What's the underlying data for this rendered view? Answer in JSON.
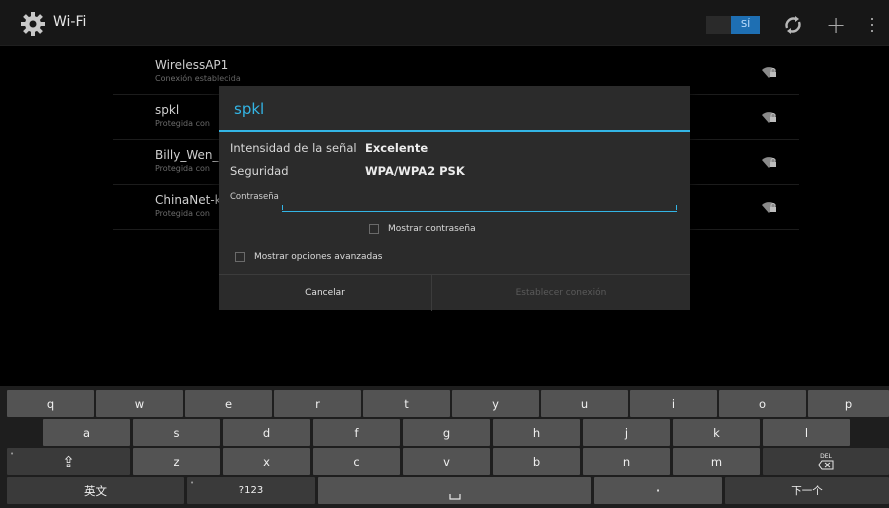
{
  "action_bar": {
    "title": "Wi-Fi",
    "icon": "gear-icon",
    "wifi_toggle_label": "SÍ",
    "buttons": [
      "wps-icon",
      "add-icon",
      "overflow-menu-icon"
    ]
  },
  "networks": [
    {
      "name": "WirelessAP1",
      "status": "Conexión establecida"
    },
    {
      "name": "spkl",
      "status": "Protegida con"
    },
    {
      "name": "Billy_Wen_0",
      "status": "Protegida con"
    },
    {
      "name": "ChinaNet-k",
      "status": "Protegida con"
    }
  ],
  "dialog": {
    "title": "spkl",
    "signal_label": "Intensidad de la señal",
    "signal_value": "Excelente",
    "security_label": "Seguridad",
    "security_value": "WPA/WPA2 PSK",
    "password_label": "Contraseña",
    "password_value": "",
    "show_password_label": "Mostrar contraseña",
    "show_password_checked": false,
    "advanced_label": "Mostrar opciones avanzadas",
    "advanced_checked": false,
    "cancel_label": "Cancelar",
    "connect_label": "Establecer conexión",
    "connect_enabled": false
  },
  "keyboard": {
    "row1": [
      "q",
      "w",
      "e",
      "r",
      "t",
      "y",
      "u",
      "i",
      "o",
      "p"
    ],
    "row2": [
      "a",
      "s",
      "d",
      "f",
      "g",
      "h",
      "j",
      "k",
      "l"
    ],
    "row3": [
      "z",
      "x",
      "c",
      "v",
      "b",
      "n",
      "m"
    ],
    "shift_label": "⇪",
    "delete_label": "DEL",
    "lang_label": "英文",
    "symbols_label": "?123",
    "period_label": "·",
    "next_label": "下一个",
    "colors": {
      "key": "#535353",
      "accent": "#33b5e5"
    }
  },
  "colors": {
    "accent": "#33b5e5",
    "toggle": "#1e6fb3"
  }
}
